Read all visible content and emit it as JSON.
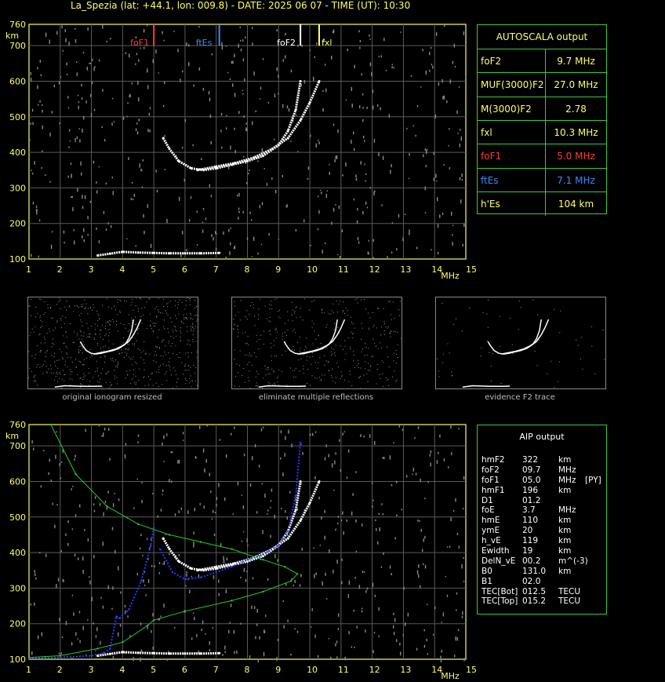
{
  "header": {
    "title": "La_Spezia (lat: +44.1, lon: 009.8) - DATE: 2025 06 07 - TIME (UT): 10:30"
  },
  "autoscala": {
    "title": "AUTOSCALA output",
    "rows": [
      {
        "name": "foF2",
        "value": "9.7 MHz",
        "color": "#ffff66"
      },
      {
        "name": "MUF(3000)F2",
        "value": "27.0 MHz",
        "color": "#ffff66"
      },
      {
        "name": "M(3000)F2",
        "value": "2.78",
        "color": "#ffff66"
      },
      {
        "name": "fxl",
        "value": "10.3 MHz",
        "color": "#ffff66"
      },
      {
        "name": "foF1",
        "value": "5.0 MHz",
        "color": "#ff3b3b"
      },
      {
        "name": "ftEs",
        "value": "7.1 MHz",
        "color": "#3b8bff"
      },
      {
        "name": "h'Es",
        "value": "104     km",
        "color": "#ffff66"
      }
    ]
  },
  "aip": {
    "title": "AIP output",
    "rows": [
      {
        "name": "hmF2",
        "value": "322",
        "unit": "km",
        "extra": ""
      },
      {
        "name": "foF2",
        "value": "09.7",
        "unit": "MHz",
        "extra": ""
      },
      {
        "name": "foF1",
        "value": "05.0",
        "unit": "MHz",
        "extra": "[PY]"
      },
      {
        "name": "hmF1",
        "value": "196",
        "unit": "km",
        "extra": ""
      },
      {
        "name": "D1",
        "value": "01.2",
        "unit": "",
        "extra": ""
      },
      {
        "name": "foE",
        "value": "3.7",
        "unit": "MHz",
        "extra": ""
      },
      {
        "name": "hmE",
        "value": "110",
        "unit": "km",
        "extra": ""
      },
      {
        "name": "ymE",
        "value": "20",
        "unit": "km",
        "extra": ""
      },
      {
        "name": "h_vE",
        "value": "119",
        "unit": "km",
        "extra": ""
      },
      {
        "name": "Ewidth",
        "value": "19",
        "unit": "km",
        "extra": ""
      },
      {
        "name": "DelN_vE",
        "value": "00.2",
        "unit": "m^(-3)",
        "extra": ""
      },
      {
        "name": "B0",
        "value": "131.0",
        "unit": "km",
        "extra": ""
      },
      {
        "name": "B1",
        "value": "02.0",
        "unit": "",
        "extra": ""
      },
      {
        "name": "TEC[Bot]",
        "value": "012.5",
        "unit": "TECU",
        "extra": ""
      },
      {
        "name": "TEC[Top]",
        "value": "015.2",
        "unit": "TECU",
        "extra": ""
      }
    ]
  },
  "captions": {
    "thumb1": "original ionogram resized",
    "thumb2": "eliminate multiple reflections",
    "thumb3": "evidence F2 trace"
  },
  "chart_data": [
    {
      "type": "scatter",
      "title": "",
      "xlabel": "MHz",
      "ylabel": "km",
      "xlim": [
        1,
        15
      ],
      "ylim": [
        100,
        760
      ],
      "x_ticks": [
        "1",
        "2",
        "3",
        "4",
        "5",
        "6",
        "7",
        "8",
        "9",
        "10",
        "11",
        "12",
        "13",
        "14",
        "15"
      ],
      "y_ticks": [
        "100",
        "200",
        "300",
        "400",
        "500",
        "600",
        "700",
        "760"
      ],
      "grid": true,
      "markers": [
        {
          "label": "foF1",
          "x": 5.0,
          "color": "#ff3b3b"
        },
        {
          "label": "ftEs",
          "x": 7.1,
          "color": "#3b8bff"
        },
        {
          "label": "foF2",
          "x": 9.7,
          "color": "#ffffff"
        },
        {
          "label": "fxl",
          "x": 10.3,
          "color": "#ffff66"
        }
      ],
      "series": [
        {
          "color": "#ffffff",
          "points": [
            [
              5.3,
              440
            ],
            [
              5.5,
              410
            ],
            [
              5.8,
              375
            ],
            [
              6.2,
              355
            ],
            [
              6.6,
              350
            ],
            [
              7.0,
              355
            ],
            [
              7.5,
              365
            ],
            [
              8.0,
              375
            ],
            [
              8.5,
              390
            ],
            [
              9.0,
              420
            ],
            [
              9.3,
              460
            ],
            [
              9.55,
              520
            ],
            [
              9.7,
              600
            ]
          ]
        },
        {
          "color": "#ffffff",
          "points": [
            [
              6.4,
              350
            ],
            [
              7.0,
              360
            ],
            [
              7.6,
              370
            ],
            [
              8.2,
              385
            ],
            [
              8.8,
              410
            ],
            [
              9.3,
              440
            ],
            [
              9.7,
              490
            ],
            [
              10.0,
              540
            ],
            [
              10.3,
              600
            ]
          ]
        },
        {
          "color": "#ffffff",
          "points": [
            [
              3.2,
              110
            ],
            [
              3.6,
              115
            ],
            [
              4.0,
              120
            ],
            [
              4.5,
              118
            ],
            [
              5.0,
              117
            ],
            [
              5.5,
              116
            ],
            [
              6.0,
              116
            ],
            [
              6.5,
              116
            ],
            [
              7.1,
              117
            ]
          ]
        }
      ]
    },
    {
      "type": "line",
      "title": "",
      "xlabel": "MHz",
      "ylabel": "km",
      "xlim": [
        1,
        15
      ],
      "ylim": [
        100,
        760
      ],
      "x_ticks": [
        "1",
        "2",
        "3",
        "4",
        "5",
        "6",
        "7",
        "8",
        "9",
        "10",
        "11",
        "12",
        "13",
        "14",
        "15"
      ],
      "y_ticks": [
        "100",
        "200",
        "300",
        "400",
        "500",
        "600",
        "700",
        "760"
      ],
      "grid": true,
      "series": [
        {
          "color": "#ffffff",
          "points": [
            [
              5.3,
              440
            ],
            [
              5.5,
              410
            ],
            [
              5.8,
              375
            ],
            [
              6.2,
              355
            ],
            [
              6.6,
              350
            ],
            [
              7.0,
              355
            ],
            [
              7.5,
              365
            ],
            [
              8.0,
              375
            ],
            [
              8.5,
              390
            ],
            [
              9.0,
              420
            ],
            [
              9.3,
              460
            ],
            [
              9.55,
              520
            ],
            [
              9.7,
              600
            ]
          ]
        },
        {
          "color": "#ffffff",
          "points": [
            [
              6.4,
              350
            ],
            [
              7.0,
              360
            ],
            [
              7.6,
              370
            ],
            [
              8.2,
              385
            ],
            [
              8.8,
              410
            ],
            [
              9.3,
              440
            ],
            [
              9.7,
              490
            ],
            [
              10.0,
              540
            ],
            [
              10.3,
              600
            ]
          ]
        },
        {
          "color": "#ffffff",
          "points": [
            [
              3.2,
              110
            ],
            [
              3.6,
              115
            ],
            [
              4.0,
              120
            ],
            [
              4.5,
              118
            ],
            [
              5.0,
              117
            ],
            [
              5.5,
              116
            ],
            [
              6.0,
              116
            ],
            [
              6.5,
              116
            ],
            [
              7.1,
              117
            ]
          ]
        },
        {
          "color": "#2a3cff",
          "points": [
            [
              1,
              103
            ],
            [
              2,
              105
            ],
            [
              3,
              110
            ],
            [
              3.4,
              118
            ],
            [
              3.6,
              130
            ],
            [
              3.8,
              220
            ],
            [
              3.9,
              215
            ],
            [
              4.2,
              240
            ],
            [
              4.6,
              320
            ],
            [
              4.9,
              420
            ],
            [
              5.0,
              470
            ]
          ]
        },
        {
          "color": "#2a3cff",
          "points": [
            [
              5.2,
              410
            ],
            [
              5.6,
              345
            ],
            [
              6.0,
              325
            ],
            [
              6.5,
              330
            ],
            [
              7.0,
              345
            ],
            [
              7.5,
              360
            ],
            [
              8.0,
              380
            ],
            [
              8.5,
              395
            ],
            [
              9.0,
              420
            ],
            [
              9.3,
              460
            ],
            [
              9.55,
              560
            ],
            [
              9.7,
              710
            ]
          ]
        },
        {
          "color": "#22cc22",
          "points": [
            [
              1.7,
              760
            ],
            [
              2.5,
              620
            ],
            [
              3.5,
              530
            ],
            [
              4.5,
              480
            ],
            [
              5.5,
              450
            ],
            [
              6.5,
              430
            ],
            [
              7.5,
              410
            ],
            [
              8.5,
              380
            ],
            [
              9.2,
              360
            ],
            [
              9.6,
              340
            ],
            [
              9.4,
              320
            ],
            [
              8.5,
              290
            ],
            [
              7.5,
              265
            ],
            [
              6.0,
              235
            ],
            [
              5.0,
              210
            ],
            [
              4.8,
              195
            ],
            [
              4.0,
              148
            ],
            [
              3.2,
              130
            ],
            [
              2.0,
              110
            ],
            [
              1.0,
              105
            ]
          ]
        }
      ]
    }
  ]
}
